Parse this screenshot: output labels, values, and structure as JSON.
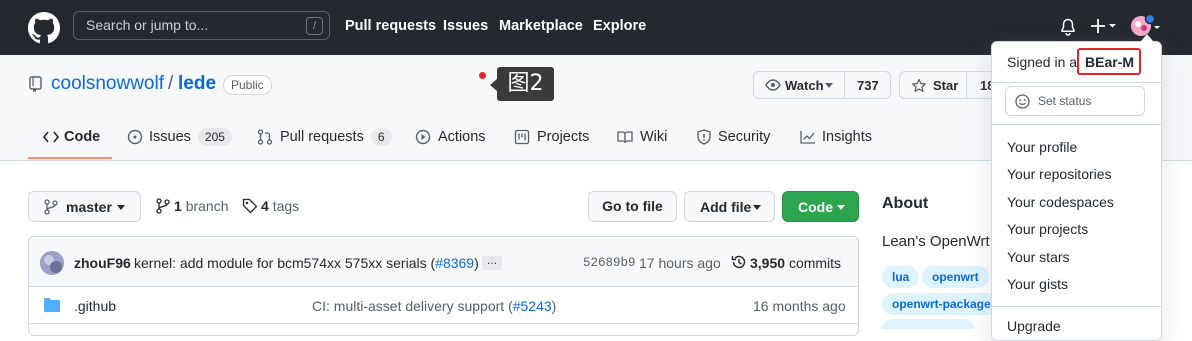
{
  "header": {
    "search_placeholder": "Search or jump to...",
    "search_key": "/",
    "nav": [
      "Pull requests",
      "Issues",
      "Marketplace",
      "Explore"
    ]
  },
  "repo": {
    "owner": "coolsnowwolf",
    "separator": "/",
    "name": "lede",
    "visibility": "Public",
    "watch_label": "Watch",
    "watch_count": "737",
    "star_label": "Star",
    "star_count_partial": "18"
  },
  "annotation": {
    "label": "图2"
  },
  "tabs": [
    {
      "label": "Code",
      "count": ""
    },
    {
      "label": "Issues",
      "count": "205"
    },
    {
      "label": "Pull requests",
      "count": "6"
    },
    {
      "label": "Actions",
      "count": ""
    },
    {
      "label": "Projects",
      "count": ""
    },
    {
      "label": "Wiki",
      "count": ""
    },
    {
      "label": "Security",
      "count": ""
    },
    {
      "label": "Insights",
      "count": ""
    }
  ],
  "toolbar": {
    "branch": "master",
    "branch_count": "1",
    "branch_word": "branch",
    "tag_count": "4",
    "tag_word": "tags",
    "go_to_file": "Go to file",
    "add_file": "Add file",
    "code": "Code"
  },
  "commit": {
    "author": "zhouF96",
    "message": "kernel: add module for bcm574xx 575xx serials (",
    "pr": "#8369",
    "message_end": ")",
    "ellipsis": "…",
    "sha": "52689b9",
    "time": "17 hours ago",
    "commit_count": "3,950",
    "commits_word": "commits"
  },
  "files": [
    {
      "name": ".github",
      "message": "CI: multi-asset delivery support (",
      "pr": "#5243",
      "end": ")",
      "time": "16 months ago"
    }
  ],
  "about": {
    "title": "About",
    "desc_partial": "Lean's OpenWrt",
    "topics": [
      "lua",
      "openwrt",
      "openwrt-package"
    ]
  },
  "dropdown": {
    "signed_in_as": "Signed in as",
    "username": "BEar-M",
    "set_status": "Set status",
    "items": [
      "Your profile",
      "Your repositories",
      "Your codespaces",
      "Your projects",
      "Your stars",
      "Your gists"
    ],
    "partial_item": "Upgrade"
  },
  "colors": {
    "header_bg": "#24292f",
    "accent": "#0969da",
    "green": "#2da44e",
    "highlight_border": "#e5232a",
    "tab_underline": "#fd8c73"
  }
}
